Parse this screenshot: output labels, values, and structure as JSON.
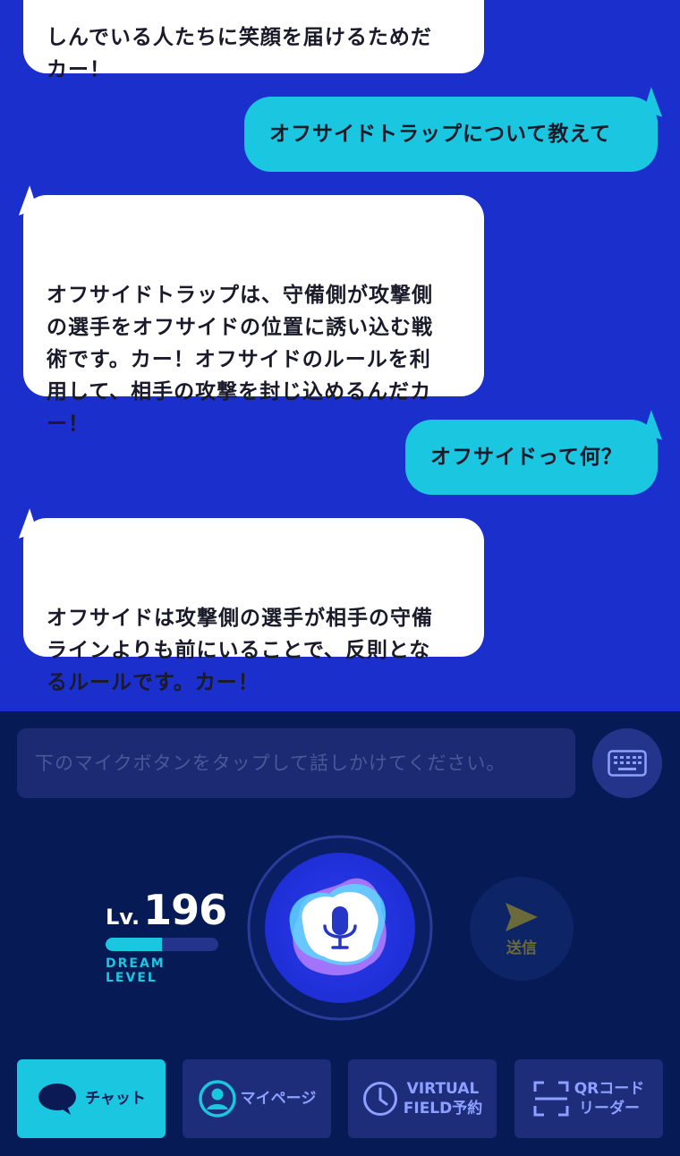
{
  "messages": [
    {
      "role": "bot",
      "text": "しんでいる人たちに笑顔を届けるためだ\nカー！"
    },
    {
      "role": "user",
      "text": "オフサイドトラップについて教えて"
    },
    {
      "role": "bot",
      "text": "オフサイドトラップは、守備側が攻撃側\nの選手をオフサイドの位置に誘い込む戦\n術です。カー！オフサイドのルールを利\n用して、相手の攻撃を封じ込めるんだカ\nー！"
    },
    {
      "role": "user",
      "text": "オフサイドって何？"
    },
    {
      "role": "bot",
      "text": "オフサイドは攻撃側の選手が相手の守備\nラインよりも前にいることで、反則とな\nるルールです。カー！"
    }
  ],
  "input": {
    "placeholder": "下のマイクボタンをタップして話しかけてください。"
  },
  "level": {
    "prefix": "Lv.",
    "value": "196",
    "label": "DREAM LEVEL",
    "progress": 0.5
  },
  "send": {
    "label": "送信"
  },
  "nav": {
    "chat": "チャット",
    "mypage": "マイページ",
    "virtual_1": "VIRTUAL",
    "virtual_2": "FIELD予約",
    "qr_1": "QRコード",
    "qr_2": "リーダー"
  },
  "colors": {
    "chat_bg": "#1a2fcc",
    "user_bubble": "#1ac6e0",
    "panel_bg": "#061a55",
    "accent": "#1ac6e0"
  }
}
